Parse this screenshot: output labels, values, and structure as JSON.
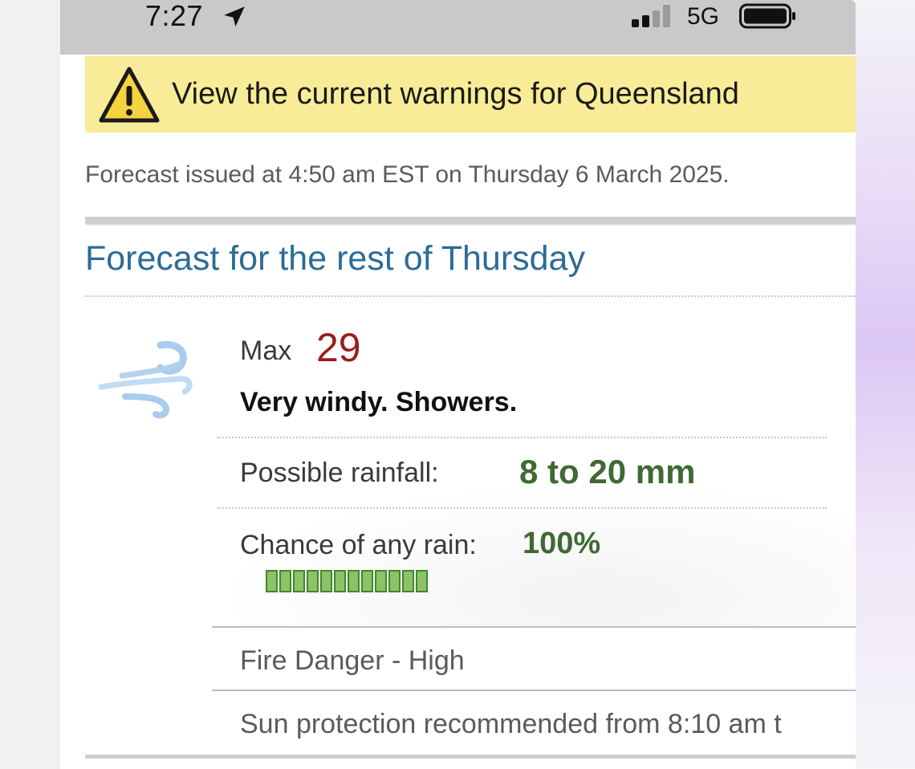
{
  "status_bar": {
    "time": "7:27",
    "network": "5G",
    "icons": [
      "location-arrow-icon",
      "signal-bars-icon",
      "battery-icon"
    ]
  },
  "warning_banner": {
    "icon": "warning-triangle-icon",
    "text": "View the current warnings for Queensland",
    "background_color": "#f8ec98"
  },
  "forecast": {
    "issued": "Forecast issued at 4:50 am EST on Thursday 6 March 2025.",
    "heading": "Forecast for the rest of Thursday",
    "weather_icon": "windy-icon",
    "max_label": "Max",
    "max_value": "29",
    "precis": "Very windy. Showers.",
    "rainfall_label": "Possible rainfall:",
    "rainfall_value": "8 to 20 mm",
    "chance_label": "Chance of any rain:",
    "chance_value": "100%",
    "chance_percent": 100,
    "chance_segments_total": 12,
    "fire_danger": "Fire Danger - High",
    "sun_protection": "Sun protection recommended from 8:10 am t"
  },
  "colors": {
    "heading": "#2c6c97",
    "max_temp": "#9a1c1c",
    "rain_value": "#3f6a33",
    "bar_fill": "#8fc166"
  }
}
